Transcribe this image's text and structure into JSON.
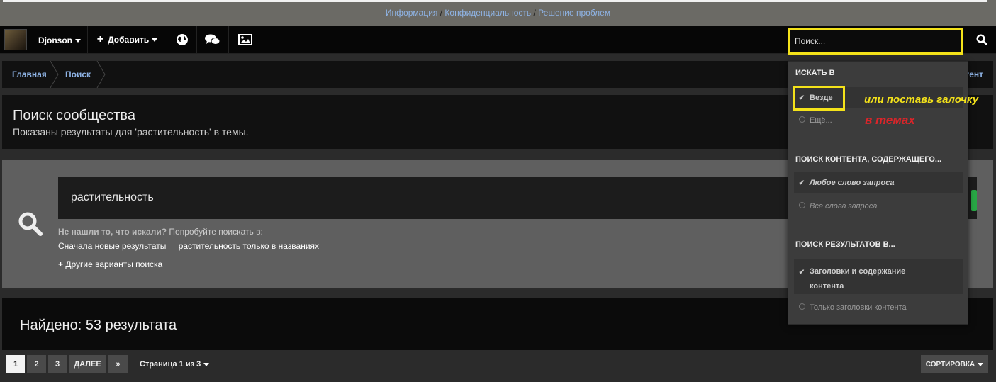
{
  "top_links": {
    "info": "Информация",
    "sep1": " / ",
    "privacy": "Конфиденциальность",
    "sep2": " / ",
    "help": "Решение проблем"
  },
  "navbar": {
    "username": "Djonson",
    "add_label": "Добавить",
    "search_placeholder": "Поиск..."
  },
  "breadcrumb": {
    "home": "Главная",
    "search": "Поиск",
    "right": "тент"
  },
  "header": {
    "title": "Поиск сообщества",
    "subtitle": "Показаны результаты для 'растительность' в темы."
  },
  "search_area": {
    "query": "растительность",
    "hint_bold": "Не нашли то, что искали?",
    "hint_rest": " Попробуйте поискать в:",
    "link_newest": "Сначала новые результаты",
    "link_titles": "растительность только в названиях",
    "more_options": "Другие варианты поиска"
  },
  "results": {
    "found": "Найдено: 53 результата"
  },
  "pagination": {
    "pages": [
      "1",
      "2",
      "3"
    ],
    "next": "ДАЛЕЕ",
    "last": "»",
    "info": "Страница 1 из 3",
    "sort": "СОРТИРОВКА"
  },
  "dropdown": {
    "search_in_head": "ИСКАТЬ В",
    "everywhere": "Везде",
    "more": "Ещё...",
    "content_head": "ПОИСК КОНТЕНТА, СОДЕРЖАЩЕГО...",
    "any_word": "Любое слово запроса",
    "all_words": "Все слова запроса",
    "results_head": "ПОИСК РЕЗУЛЬТАТОВ В...",
    "titles_content_1": "Заголовки и содержание",
    "titles_content_2": "контента",
    "titles_only": "Только заголовки контента"
  },
  "annotations": {
    "note1": "или поставь галочку",
    "note2": "в темах",
    "highlight_color": "#f4e21a",
    "note2_color": "#d9252a"
  }
}
